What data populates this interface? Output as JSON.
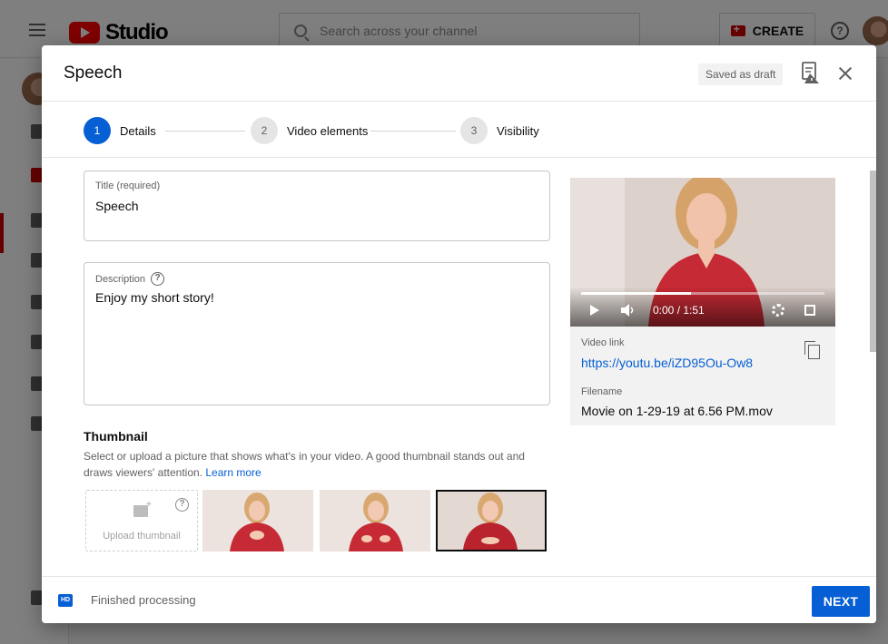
{
  "app": {
    "logo_text": "Studio",
    "search_placeholder": "Search across your channel",
    "create_label": "CREATE",
    "help_symbol": "?"
  },
  "dialog": {
    "title": "Speech",
    "saved_status": "Saved as draft",
    "steps": [
      {
        "number": "1",
        "label": "Details",
        "active": true
      },
      {
        "number": "2",
        "label": "Video elements",
        "active": false
      },
      {
        "number": "3",
        "label": "Visibility",
        "active": false
      }
    ],
    "title_field": {
      "label": "Title (required)",
      "value": "Speech"
    },
    "description_field": {
      "label": "Description",
      "value": "Enjoy my short story!"
    },
    "thumbnail": {
      "heading": "Thumbnail",
      "description": "Select or upload a picture that shows what's in your video. A good thumbnail stands out and draws viewers' attention.",
      "learn_more": "Learn more",
      "upload_label": "Upload thumbnail",
      "selected_index": 3
    },
    "video": {
      "time": "0:00 / 1:51",
      "progress_buffered": 0.45,
      "link_label": "Video link",
      "link": "https://youtu.be/iZD95Ou-Ow8",
      "filename_label": "Filename",
      "filename": "Movie on 1-29-19 at 6.56 PM.mov"
    },
    "footer": {
      "badge": "HD",
      "status": "Finished processing",
      "next_label": "NEXT"
    }
  },
  "colors": {
    "accent": "#065fd4",
    "brand_red": "#ff0000",
    "shirt_red": "#c62a34"
  }
}
